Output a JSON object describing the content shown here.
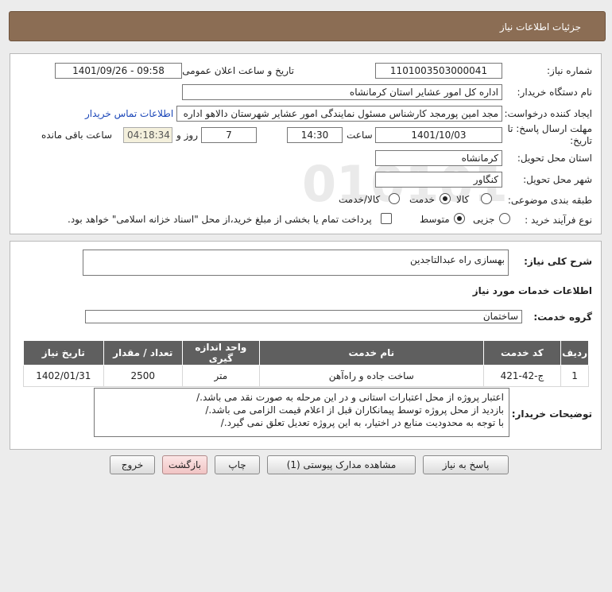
{
  "header": {
    "title": "جزئیات اطلاعات نیاز"
  },
  "fields": {
    "need_number_label": "شماره نیاز:",
    "need_number": "1101003503000041",
    "announce_label": "تاریخ و ساعت اعلان عمومی:",
    "announce_value": "1401/09/26 - 09:58",
    "buyer_label": "نام دستگاه خریدار:",
    "buyer_value": "اداره کل امور عشایر استان کرمانشاه",
    "creator_label": "ایجاد کننده درخواست:",
    "creator_value": "مجد امین پورمجد کارشناس مسئول نمایندگی امور عشایر شهرستان دالاهو اداره",
    "contact_link": "اطلاعات تماس خریدار",
    "deadline_label": "مهلت ارسال پاسخ: تا تاریخ:",
    "deadline_date": "1401/10/03",
    "time_label": "ساعت",
    "deadline_time": "14:30",
    "days_value": "7",
    "days_label": "روز و",
    "remaining_time": "04:18:34",
    "remaining_label": "ساعت باقی مانده",
    "province_label": "استان محل تحویل:",
    "province_value": "کرمانشاه",
    "city_label": "شهر محل تحویل:",
    "city_value": "کنگاور",
    "category_label": "طبقه بندی موضوعی:",
    "category_options": [
      "کالا",
      "خدمت",
      "کالا/خدمت"
    ],
    "category_selected": "خدمت",
    "process_label": "نوع فرآیند خرید :",
    "process_options": [
      "جزیی",
      "متوسط"
    ],
    "process_selected": "متوسط",
    "payment_note": "پرداخت تمام یا بخشی از مبلغ خرید،از محل \"اسناد خزانه اسلامی\" خواهد بود."
  },
  "summary": {
    "label": "شرح کلی نیاز:",
    "value": "بهسازی راه عبدالتاجدین"
  },
  "services": {
    "section_title": "اطلاعات خدمات مورد نیاز",
    "group_label": "گروه خدمت:",
    "group_value": "ساختمان",
    "columns": [
      "ردیف",
      "کد خدمت",
      "نام خدمت",
      "واحد اندازه گیری",
      "تعداد / مقدار",
      "تاریخ نیاز"
    ],
    "rows": [
      [
        "1",
        "ج-42-421",
        "ساخت جاده و راه‌آهن",
        "متر",
        "2500",
        "1402/01/31"
      ]
    ]
  },
  "buyer_notes": {
    "label": "توضیحات خریدار:",
    "lines": [
      "اعتبار پروژه از محل اعتبارات استانی و در این مرحله به صورت نقد می باشد./",
      "بازدید از محل پروژه توسط پیمانکاران قبل از اعلام قیمت الزامی می باشد./",
      "با توجه به محدودیت منابع در اختیار، به این پروژه تعدیل تعلق نمی گیرد./"
    ]
  },
  "buttons": {
    "reply": "پاسخ به نیاز",
    "attachments": "مشاهده مدارک پیوستی (1)",
    "print": "چاپ",
    "back": "بازگشت",
    "exit": "خروج"
  },
  "colors": {
    "header_bg": "#8b6d54",
    "table_header_bg": "#5f5f5f",
    "link": "#1a46b8",
    "remaining_bg": "#f4f0dc",
    "back_button_bg": "#f1c4c4"
  },
  "watermark": {
    "main": "ParsNamadData",
    "number": "010101"
  }
}
